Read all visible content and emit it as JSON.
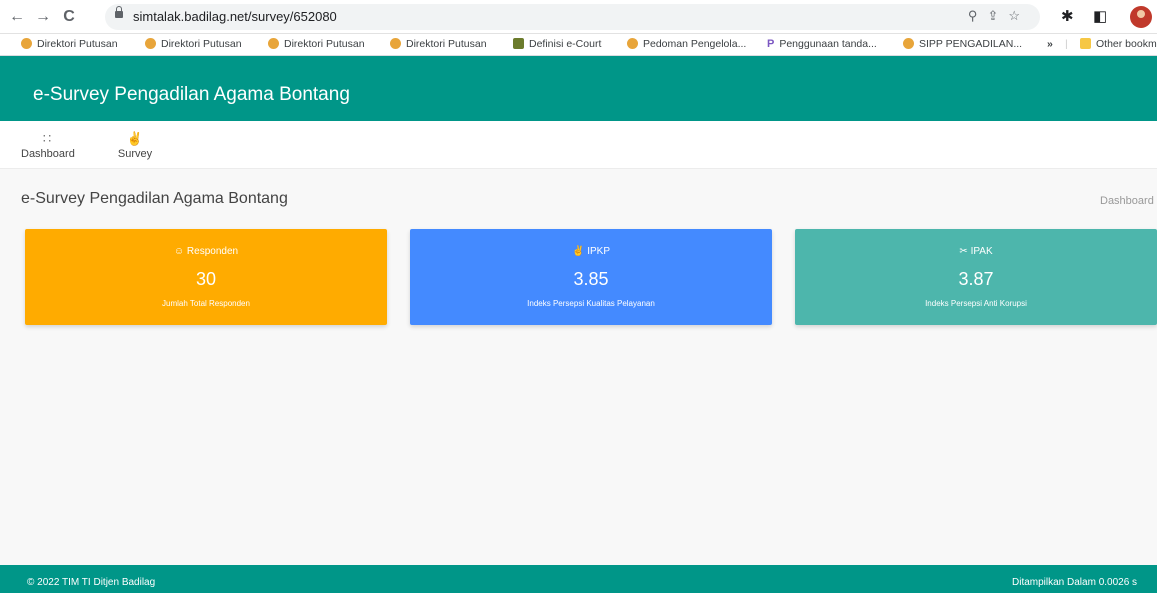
{
  "browser": {
    "url": "simtalak.badilag.net/survey/652080",
    "bookmarks": [
      {
        "label": "Direktori Putusan",
        "icon": "mahkamah-agung-icon"
      },
      {
        "label": "Direktori Putusan",
        "icon": "mahkamah-agung-icon"
      },
      {
        "label": "Direktori Putusan",
        "icon": "mahkamah-agung-icon"
      },
      {
        "label": "Direktori Putusan",
        "icon": "mahkamah-agung-icon"
      },
      {
        "label": "Definisi e-Court",
        "icon": "ecourt-icon"
      },
      {
        "label": "Pedoman Pengelola...",
        "icon": "mahkamah-agung-icon"
      },
      {
        "label": "Penggunaan tanda...",
        "icon": "p-icon"
      },
      {
        "label": "SIPP PENGADILAN...",
        "icon": "mahkamah-agung-icon"
      }
    ],
    "more_bookmarks": "»",
    "other_bookmarks": "Other bookm"
  },
  "header": {
    "title": "e-Survey Pengadilan Agama Bontang"
  },
  "menu": [
    {
      "label": "Dashboard",
      "icon": "grid-icon"
    },
    {
      "label": "Survey",
      "icon": "thumbs-up-icon"
    }
  ],
  "page": {
    "title": "e-Survey Pengadilan Agama Bontang",
    "breadcrumb": "Dashboard"
  },
  "cards": [
    {
      "label": "Responden",
      "value": "30",
      "subtitle": "Jumlah Total Responden",
      "icon": "user-icon",
      "color": "#ffab00"
    },
    {
      "label": "IPKP",
      "value": "3.85",
      "subtitle": "Indeks Persepsi Kualitas Pelayanan",
      "icon": "thumbs-up-icon",
      "color": "#448aff"
    },
    {
      "label": "IPAK",
      "value": "3.87",
      "subtitle": "Indeks Persepsi Anti Korupsi",
      "icon": "scissors-icon",
      "color": "#4db6ac"
    }
  ],
  "footer": {
    "left": "© 2022 TIM TI Ditjen Badilag",
    "right": "Ditampilkan Dalam 0.0026 s"
  },
  "colors": {
    "brand": "#009688",
    "page_bg": "#f8f8f8"
  }
}
